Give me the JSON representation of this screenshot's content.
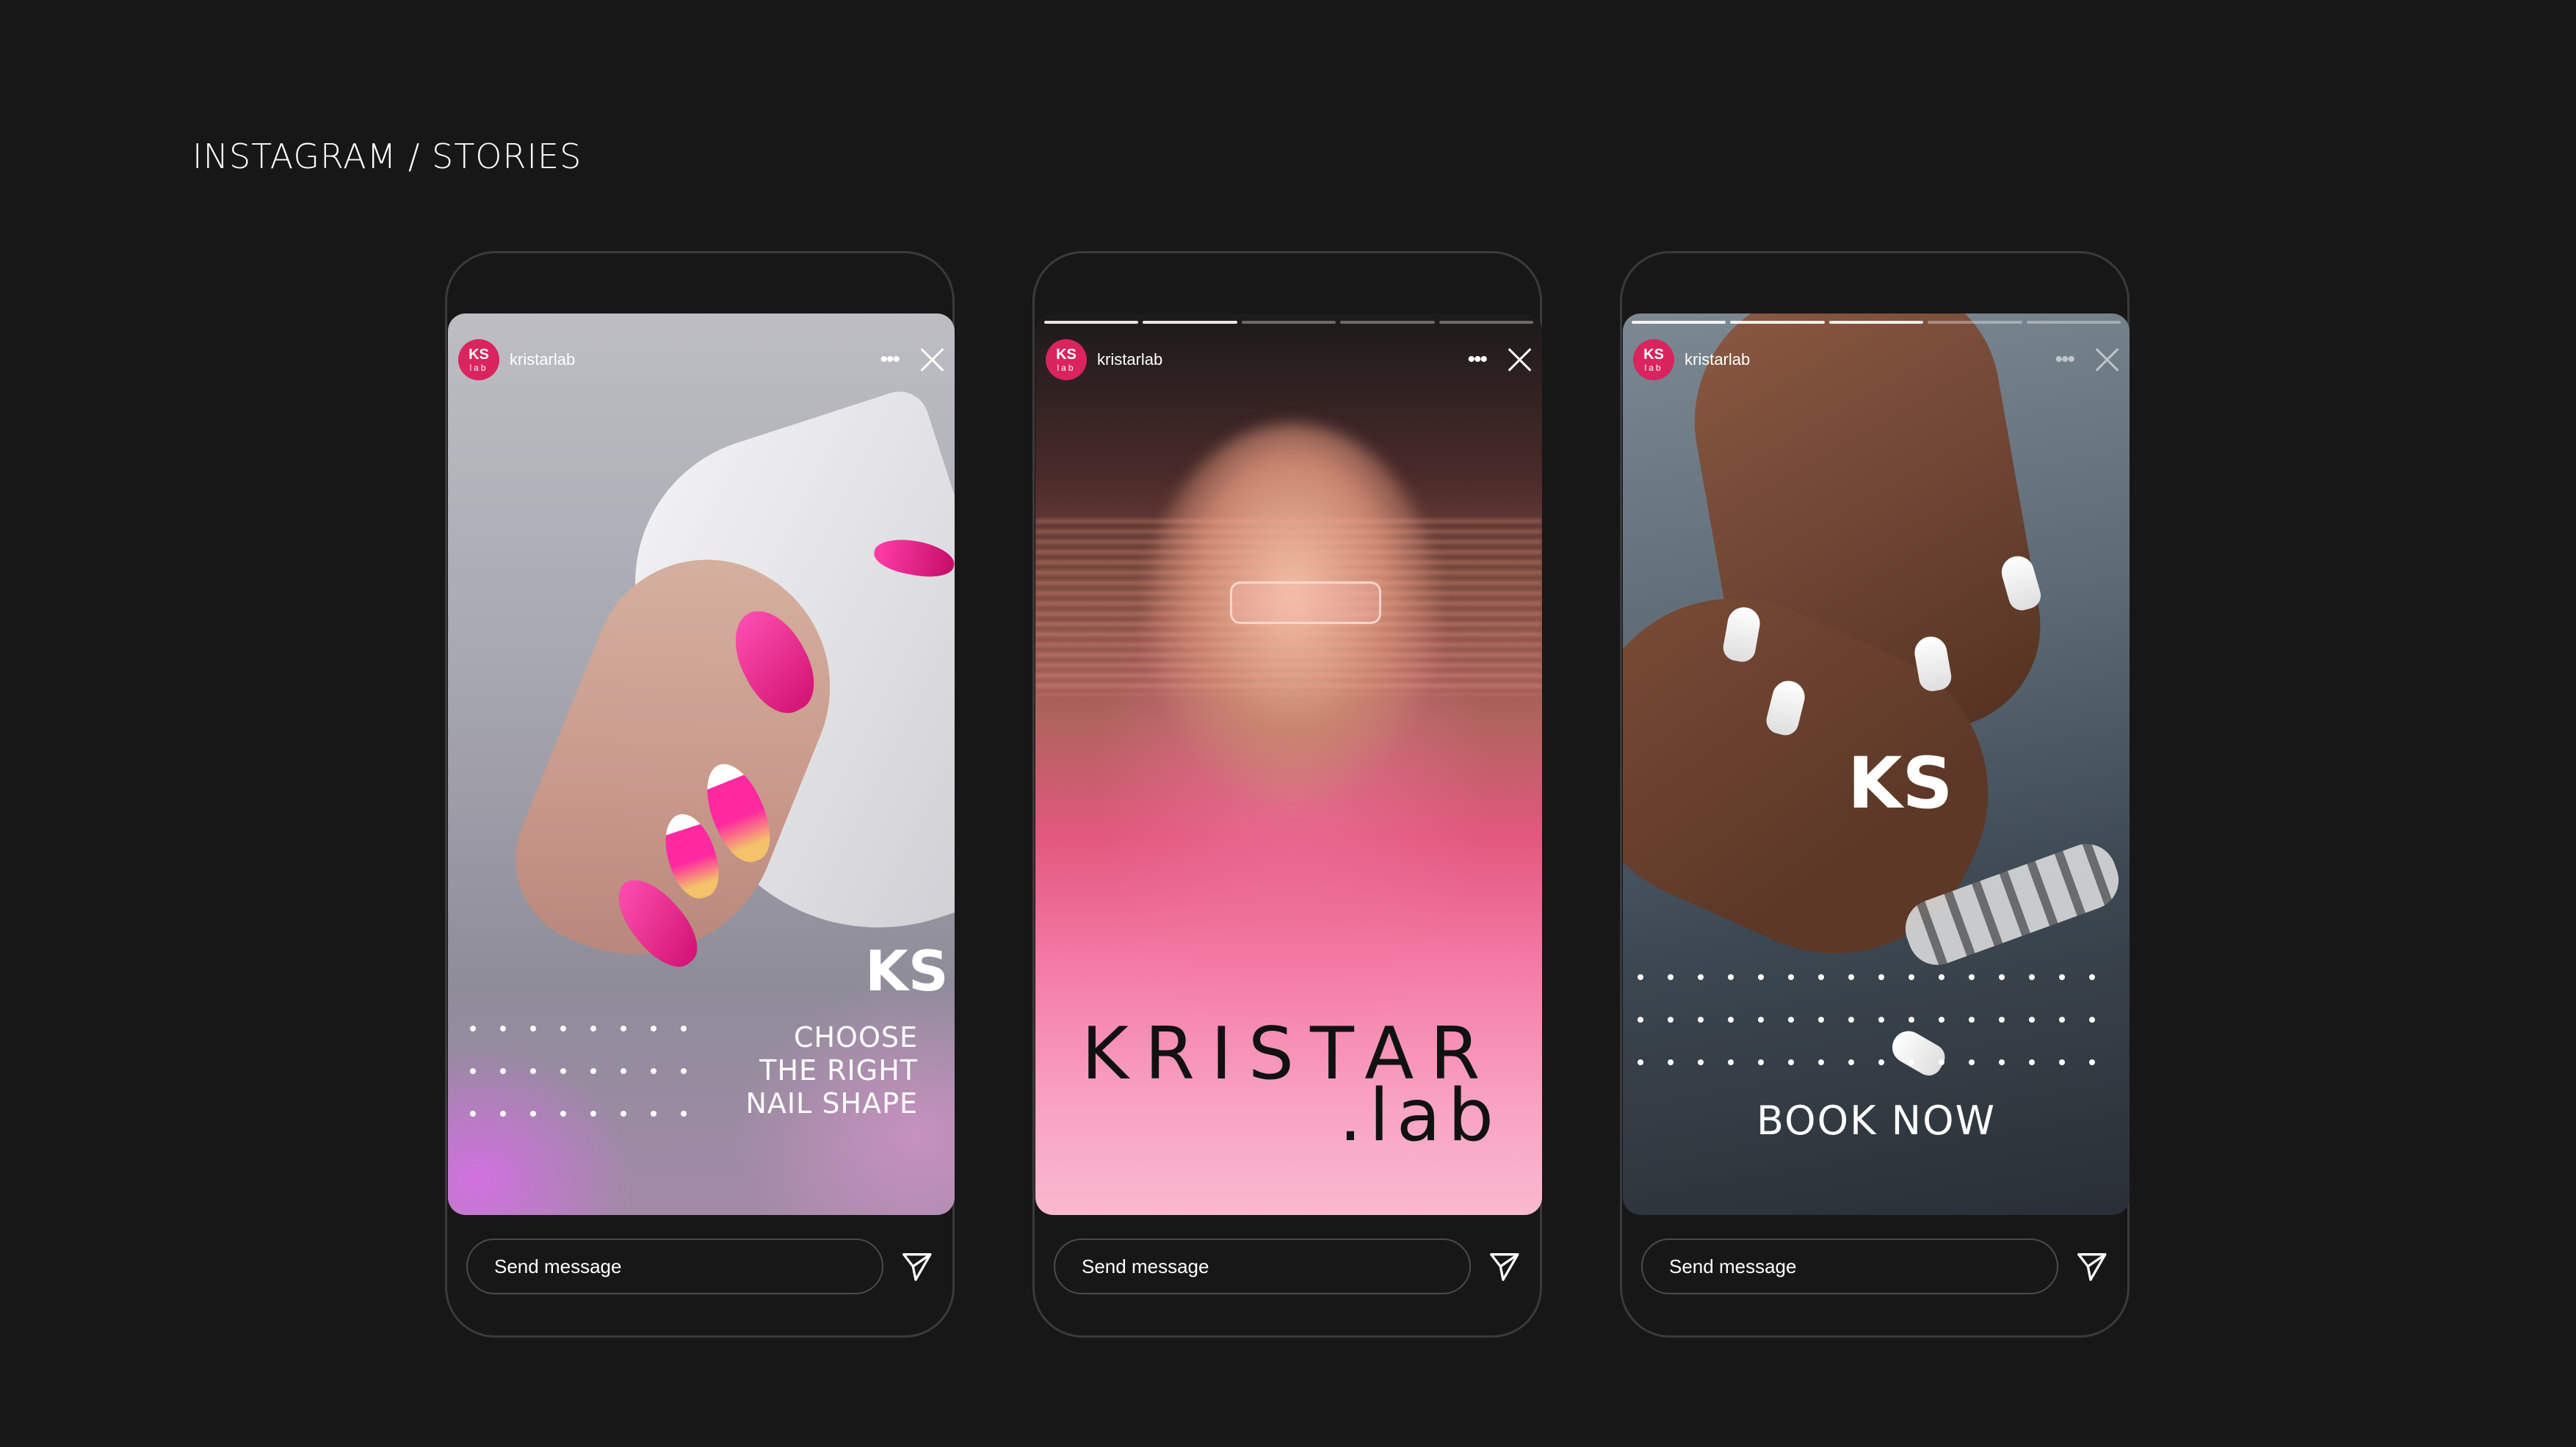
{
  "page": {
    "title": "INSTAGRAM / STORIES"
  },
  "stories": [
    {
      "username": "kristarlab",
      "avatar_mark": "KS",
      "avatar_sub": "lab",
      "logo_mark": "KS",
      "promo_lines": [
        "CHOOSE",
        "THE RIGHT",
        "NAIL SHAPE"
      ],
      "reply_placeholder": "Send message"
    },
    {
      "username": "kristarlab",
      "avatar_mark": "KS",
      "avatar_sub": "lab",
      "brand_main": "KRISTAR",
      "brand_sub": ".lab",
      "reply_placeholder": "Send message"
    },
    {
      "username": "kristarlab",
      "avatar_mark": "KS",
      "avatar_sub": "lab",
      "logo_mark": "KS",
      "cta": "BOOK NOW",
      "reply_placeholder": "Send message"
    }
  ],
  "icons": {
    "more": "more-icon",
    "close": "close-icon",
    "send": "send-icon"
  },
  "colors": {
    "background": "#171717",
    "avatar": "#d9245e",
    "frame": "#3a3a3a"
  }
}
